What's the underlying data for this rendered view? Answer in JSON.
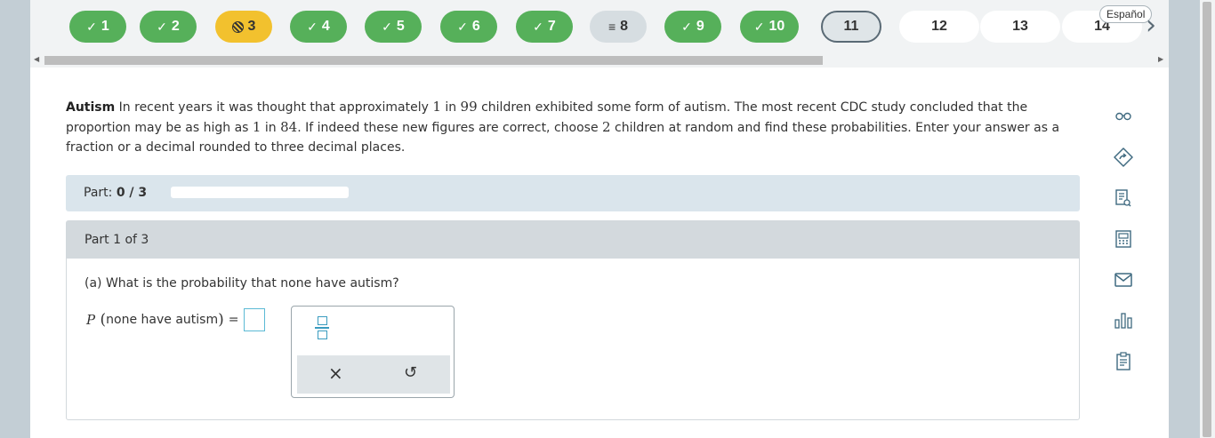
{
  "nav": {
    "questions": [
      {
        "label": "1",
        "state": "done",
        "mark": "✓"
      },
      {
        "label": "2",
        "state": "done",
        "mark": "✓"
      },
      {
        "label": "3",
        "state": "partial",
        "mark": ""
      },
      {
        "label": "4",
        "state": "done",
        "mark": "✓"
      },
      {
        "label": "5",
        "state": "done",
        "mark": "✓"
      },
      {
        "label": "6",
        "state": "done",
        "mark": "✓"
      },
      {
        "label": "7",
        "state": "done",
        "mark": "✓"
      },
      {
        "label": "8",
        "state": "flagged",
        "mark": "≡"
      },
      {
        "label": "9",
        "state": "done",
        "mark": "✓"
      },
      {
        "label": "10",
        "state": "done",
        "mark": "✓"
      },
      {
        "label": "11",
        "state": "current",
        "mark": ""
      },
      {
        "label": "12",
        "state": "open",
        "mark": ""
      },
      {
        "label": "13",
        "state": "open",
        "mark": ""
      },
      {
        "label": "14",
        "state": "open",
        "mark": ""
      }
    ],
    "espanol": "Español",
    "next_icon": "chevron-right-icon"
  },
  "question": {
    "topic": "Autism",
    "seg1": " In recent years it was thought that approximately ",
    "n1": "1",
    "seg2": " in ",
    "n2": "99",
    "seg3": " children exhibited some form of autism. The most recent CDC study concluded that the proportion may be as high as ",
    "n3": "1",
    "seg4": " in ",
    "n4": "84",
    "seg5": ". If indeed these new figures are correct, choose ",
    "n5": "2",
    "seg6": " children at random and find these probabilities. Enter your answer as a fraction or a decimal rounded to three decimal places."
  },
  "part": {
    "label": "Part: ",
    "value": "0 / 3",
    "header": "Part 1 of 3",
    "prompt": "(a) What is the probability that none have autism?",
    "eq_p": "P",
    "eq_text": "none have autism",
    "eq_sign": "="
  },
  "keypad": {
    "fraction_icon": "fraction-icon",
    "clear": "×",
    "undo": "↺"
  },
  "tools": [
    "glasses-icon",
    "answer-help-icon",
    "worksheet-icon",
    "calculator-icon",
    "message-icon",
    "chart-icon",
    "datasheet-icon"
  ],
  "colors": {
    "done": "#56b05a",
    "partial": "#f2c12e",
    "accent": "#3f6a80"
  }
}
